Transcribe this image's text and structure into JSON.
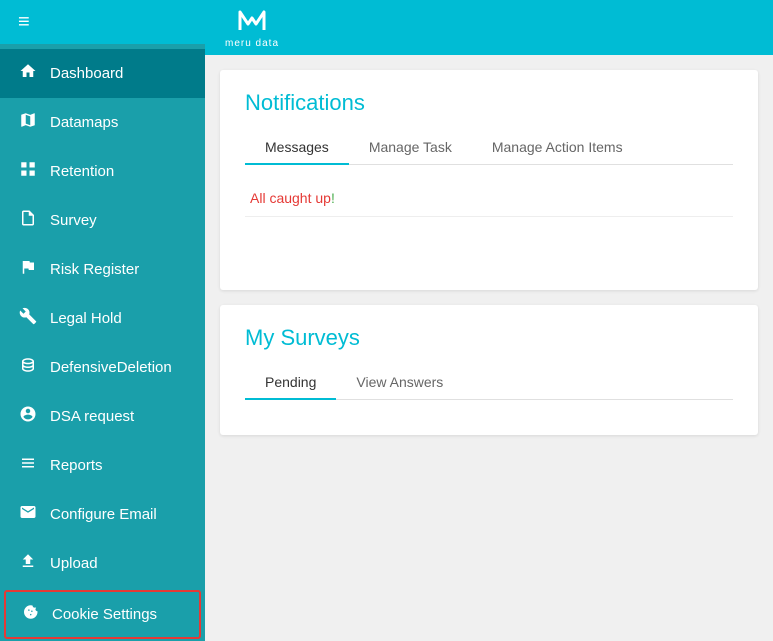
{
  "sidebar": {
    "hamburger": "≡",
    "items": [
      {
        "id": "dashboard",
        "label": "Dashboard",
        "icon": "home",
        "active": true
      },
      {
        "id": "datamaps",
        "label": "Datamaps",
        "icon": "map"
      },
      {
        "id": "retention",
        "label": "Retention",
        "icon": "grid"
      },
      {
        "id": "survey",
        "label": "Survey",
        "icon": "file"
      },
      {
        "id": "risk-register",
        "label": "Risk Register",
        "icon": "flag"
      },
      {
        "id": "legal-hold",
        "label": "Legal Hold",
        "icon": "tool"
      },
      {
        "id": "defensive-deletion",
        "label": "DefensiveDeletion",
        "icon": "database"
      },
      {
        "id": "dsa-request",
        "label": "DSA request",
        "icon": "circle-user"
      },
      {
        "id": "reports",
        "label": "Reports",
        "icon": "list"
      },
      {
        "id": "configure-email",
        "label": "Configure Email",
        "icon": "mail"
      },
      {
        "id": "upload",
        "label": "Upload",
        "icon": "upload"
      },
      {
        "id": "cookie-settings",
        "label": "Cookie Settings",
        "icon": "cookie",
        "highlighted": true
      }
    ]
  },
  "topbar": {
    "logo_icon": "M",
    "logo_text": "meru data"
  },
  "notifications": {
    "title": "Notifications",
    "tabs": [
      {
        "id": "messages",
        "label": "Messages",
        "active": true
      },
      {
        "id": "manage-task",
        "label": "Manage Task"
      },
      {
        "id": "manage-action-items",
        "label": "Manage Action Items"
      }
    ],
    "message_text_1": "All caught up",
    "message_text_2": "!"
  },
  "surveys": {
    "title": "My Surveys",
    "tabs": [
      {
        "id": "pending",
        "label": "Pending",
        "active": true
      },
      {
        "id": "view-answers",
        "label": "View Answers"
      }
    ]
  }
}
